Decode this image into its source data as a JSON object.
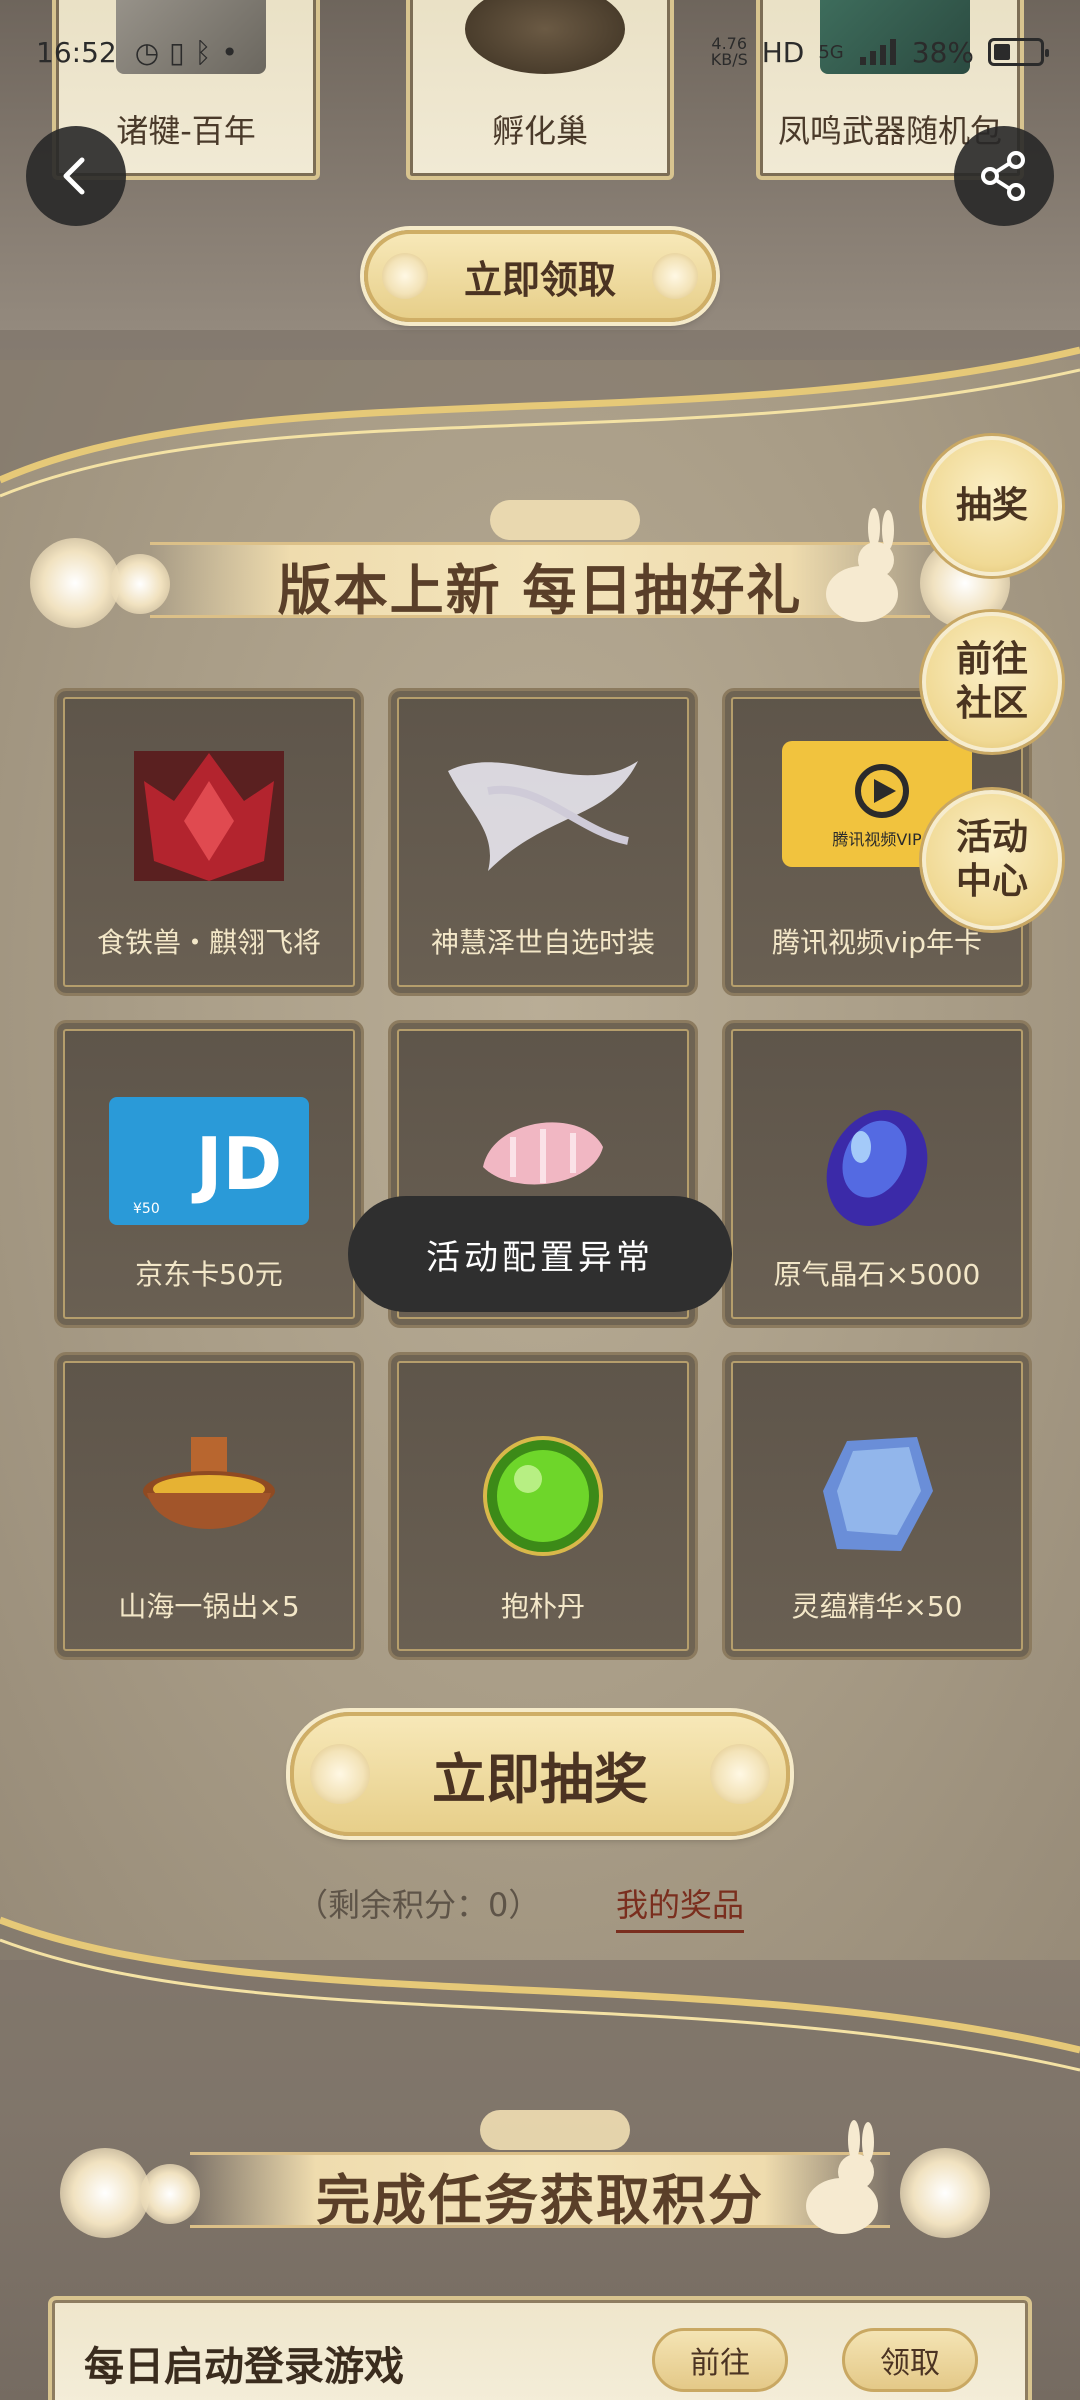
{
  "status_bar": {
    "time": "16:52",
    "net_speed_value": "4.76",
    "net_speed_unit": "KB/S",
    "hd_label": "HD",
    "network": "5G",
    "battery": "38%"
  },
  "top_rewards": [
    {
      "label": "诸犍-百年"
    },
    {
      "label": "孵化巢"
    },
    {
      "label": "凤鸣武器随机包"
    }
  ],
  "claim_button": "立即领取",
  "draw_section": {
    "banner_title": "版本上新 每日抽好礼",
    "prizes": [
      {
        "name": "食铁兽・麒翎飞将",
        "icon": "beast-icon"
      },
      {
        "name": "神慧泽世自选时装",
        "icon": "costume-icon"
      },
      {
        "name": "腾讯视频vip年卡",
        "icon": "tencent-video-vip-card-icon",
        "card_text": "腾讯视频VIP"
      },
      {
        "name": "京东卡50元",
        "icon": "jd-card-icon",
        "card_text": "JD",
        "card_value": "¥50"
      },
      {
        "name": "",
        "icon": "pink-shell-icon"
      },
      {
        "name": "原气晶石×5000",
        "icon": "crystal-icon"
      },
      {
        "name": "山海一锅出×5",
        "icon": "hotpot-icon"
      },
      {
        "name": "抱朴丹",
        "icon": "green-pill-icon"
      },
      {
        "name": "灵蕴精华×50",
        "icon": "essence-stone-icon"
      }
    ],
    "draw_button": "立即抽奖",
    "remaining_points": "（剩余积分：0）",
    "my_prizes": "我的奖品"
  },
  "side_buttons": {
    "lottery": "抽奖",
    "community_line1": "前往",
    "community_line2": "社区",
    "activity_line1": "活动",
    "activity_line2": "中心"
  },
  "toast": "活动配置异常",
  "task_section": {
    "banner_title": "完成任务获取积分",
    "task_title": "每日启动登录游戏",
    "goto_button": "前往",
    "claim_button": "领取"
  },
  "colors": {
    "accent_gold": "#e7cf8a",
    "text_brown": "#4b3322",
    "toast_bg": "#2f2f2f"
  }
}
